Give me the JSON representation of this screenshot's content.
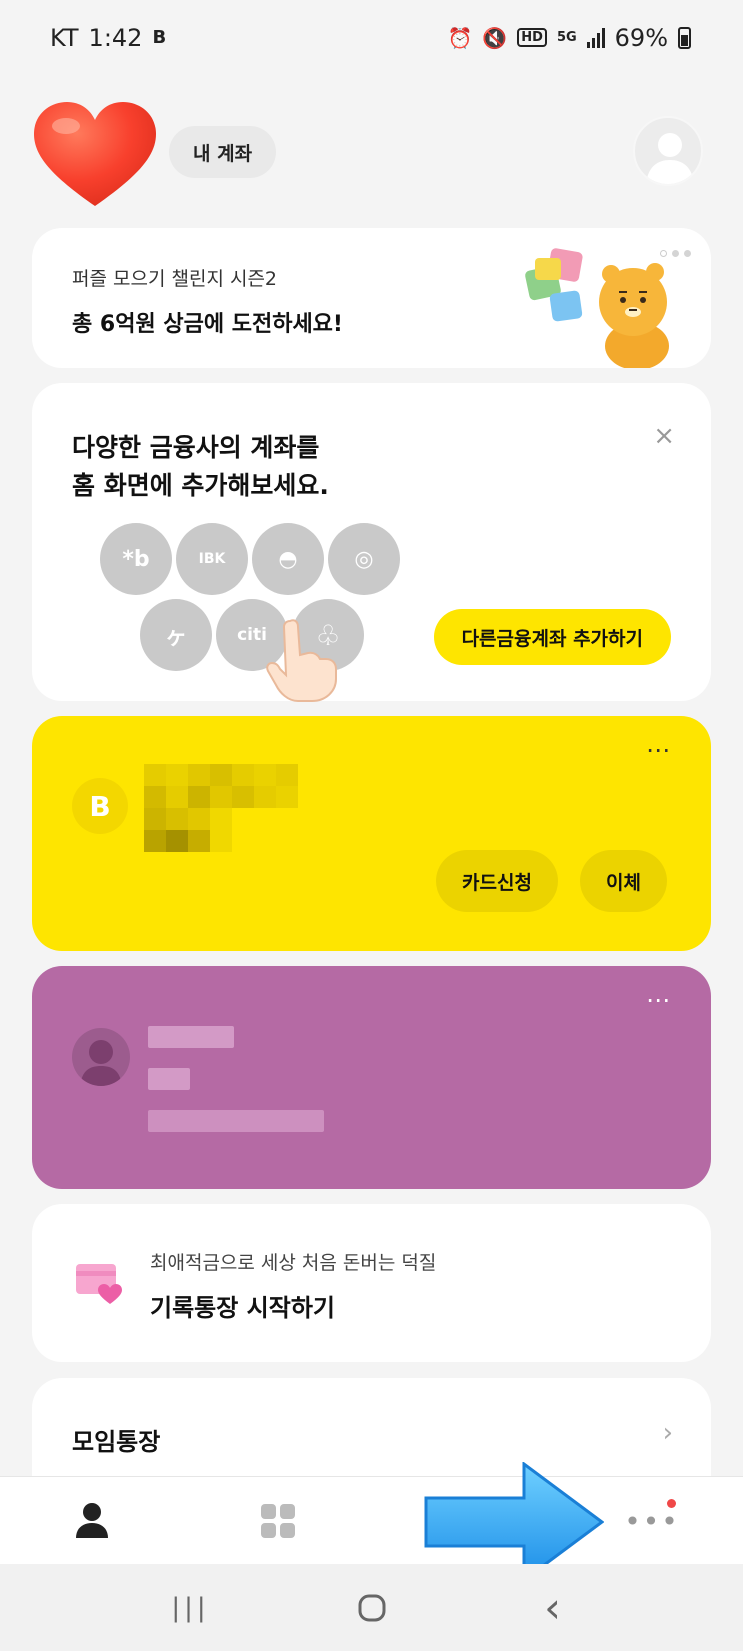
{
  "status_bar": {
    "carrier": "KT",
    "time": "1:42",
    "app_badge": "B",
    "network": "5G",
    "hd": "HD",
    "battery": "69%"
  },
  "header": {
    "my_account_label": "내 계좌"
  },
  "promo": {
    "subtitle": "퍼즐 모으기 챌린지 시즌2",
    "title": "총 6억원 상금에 도전하세요!"
  },
  "add_financial": {
    "title_line1": "다양한 금융사의 계좌를",
    "title_line2": "홈 화면에 추가해보세요.",
    "close_icon": "×",
    "button_label": "다른금융계좌 추가하기",
    "bank_icons": [
      "*b",
      "IBK",
      "◓",
      "◎",
      "ヶ",
      "citi",
      "♧"
    ]
  },
  "kakao_account": {
    "logo_letter": "B",
    "more_icon": "⋯",
    "card_apply_label": "카드신청",
    "transfer_label": "이체",
    "color": "#fee500"
  },
  "purple_account": {
    "more_icon": "⋯",
    "color": "#b56aa4"
  },
  "record": {
    "subtitle": "최애적금으로 세상 처음 돈버는 덕질",
    "title": "기록통장 시작하기"
  },
  "group": {
    "title": "모임통장",
    "chevron": "›"
  },
  "tabbar": {
    "more_icon": "•••",
    "has_new_badge": true
  },
  "navbar": {
    "recents_icon": "|||",
    "home_icon": "◯",
    "back_icon": "‹"
  }
}
